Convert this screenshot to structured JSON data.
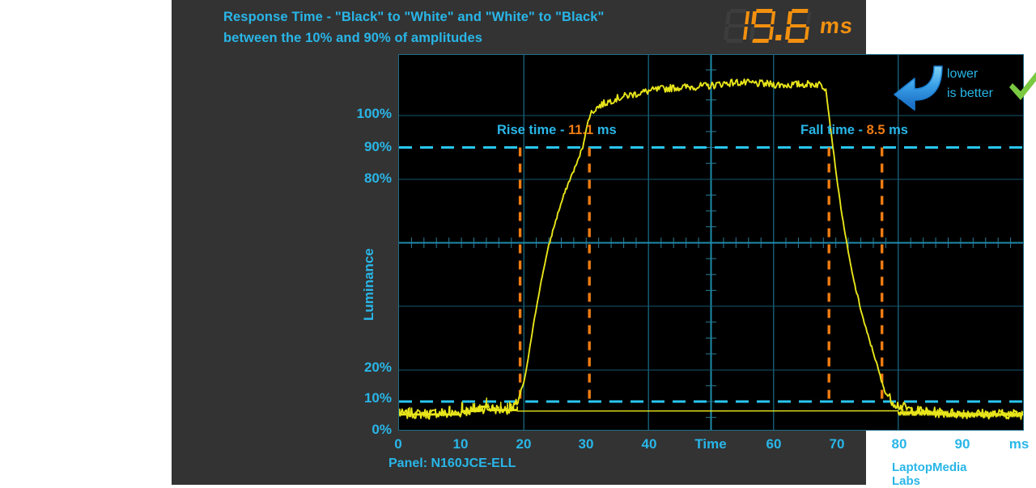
{
  "chart_data": {
    "type": "line",
    "title": "Response Time - \"Black\" to \"White\" and \"White\" to \"Black\"\nbetween the 10% and 90% of amplitudes",
    "xlabel": "Time",
    "ylabel": "Luminance",
    "xunit": "ms",
    "xlim": [
      0,
      100
    ],
    "ylim": [
      -4,
      108
    ],
    "grid": true,
    "legend": "none",
    "xticks": [
      "0",
      "10",
      "20",
      "30",
      "40",
      "Time",
      "60",
      "70",
      "80",
      "90",
      "ms"
    ],
    "xtick_values": [
      0,
      10,
      20,
      30,
      40,
      50,
      60,
      70,
      80,
      90,
      100
    ],
    "yticks": [
      "100%",
      "90%",
      "80%",
      "20%",
      "10%",
      "0%"
    ],
    "ytick_values": [
      100,
      90,
      80,
      20,
      10,
      0
    ],
    "threshold_lines": [
      {
        "label": "90%",
        "value": 90,
        "color": "#29b6e8",
        "style": "dashed"
      },
      {
        "label": "10%",
        "value": 10,
        "color": "#29b6e8",
        "style": "dashed"
      }
    ],
    "markers": [
      {
        "label": "rise-start",
        "x": 19.4,
        "color": "#ef7c12",
        "style": "dashed"
      },
      {
        "label": "rise-end",
        "x": 30.5,
        "color": "#ef7c12",
        "style": "dashed"
      },
      {
        "label": "fall-start",
        "x": 68.9,
        "color": "#ef7c12",
        "style": "dashed"
      },
      {
        "label": "fall-end",
        "x": 77.4,
        "color": "#ef7c12",
        "style": "dashed"
      }
    ],
    "series": [
      {
        "name": "Luminance response",
        "color": "#e8e51a",
        "x": [
          0,
          1,
          2,
          3,
          4,
          5,
          6,
          7,
          8,
          9,
          10,
          11,
          12,
          13,
          14,
          15,
          16,
          17,
          18,
          18.6,
          19.2,
          19.6,
          20,
          20.5,
          21,
          21.6,
          22.2,
          22.8,
          23.4,
          24,
          24.8,
          25.6,
          26.4,
          27.2,
          28,
          28.8,
          29.6,
          30.5,
          31.5,
          32.5,
          33.5,
          34.5,
          35.5,
          36.5,
          37.5,
          38.5,
          40,
          42,
          44,
          46,
          48,
          50,
          52,
          54,
          56,
          58,
          60,
          62,
          64,
          66,
          67.5,
          68.4,
          68.9,
          69.3,
          69.7,
          70.1,
          70.5,
          71,
          71.5,
          72,
          72.6,
          73.2,
          73.8,
          74.4,
          75,
          75.6,
          76.2,
          76.8,
          77.4,
          78,
          78.8,
          79.6,
          80.4,
          81.2,
          82,
          83,
          84,
          85,
          86,
          88,
          90,
          92,
          94,
          96,
          98,
          100
        ],
        "y": [
          0.8,
          0.6,
          1.0,
          0.7,
          0.9,
          0.6,
          1.1,
          0.8,
          0.6,
          1.0,
          1.2,
          1.6,
          2.0,
          2.6,
          2.2,
          2.4,
          2.0,
          2.1,
          2.3,
          3.0,
          5.5,
          8.0,
          10.0,
          15.0,
          21.0,
          28.0,
          34.5,
          40.5,
          46.0,
          51.0,
          56.5,
          61.5,
          66.0,
          70.0,
          73.5,
          77.0,
          82.0,
          90.0,
          92.0,
          93.2,
          94.0,
          94.8,
          95.3,
          95.8,
          96.2,
          96.6,
          97.2,
          97.8,
          98.2,
          98.4,
          98.6,
          98.8,
          99.5,
          99.8,
          99.6,
          99.4,
          99.2,
          99.0,
          99.2,
          99.3,
          99.2,
          98.0,
          90.0,
          84.0,
          78.0,
          72.0,
          66.5,
          60.0,
          54.5,
          49.0,
          43.0,
          38.0,
          33.5,
          29.0,
          25.0,
          21.5,
          18.0,
          14.0,
          10.0,
          7.0,
          5.0,
          3.8,
          3.0,
          2.5,
          2.0,
          1.7,
          1.5,
          1.3,
          1.2,
          1.0,
          0.9,
          0.8,
          0.8,
          0.7,
          0.7,
          0.7
        ]
      }
    ],
    "annotations": [
      {
        "name": "rise-time",
        "prefix": "Rise time - ",
        "value": "11.1",
        "suffix": " ms"
      },
      {
        "name": "fall-time",
        "prefix": "Fall time - ",
        "value": "8.5",
        "suffix": " ms"
      }
    ]
  },
  "readout": {
    "value": "19.6",
    "unit": "ms",
    "digits": [
      "1",
      "9",
      ".",
      "6"
    ],
    "color": "#f2900f",
    "ghost_color": "#3d3d3d"
  },
  "badge": {
    "text": "lower\nis better",
    "arrow_icon": "down-arrow-icon",
    "check_icon": "check-icon",
    "arrow_color": "#2f8fe0",
    "check_color": "#7ac943"
  },
  "footer": {
    "panel": "Panel: N160JCE-ELL",
    "brand": "LaptopMedia Labs"
  },
  "colors": {
    "card_bg": "#333333",
    "plot_bg": "#000000",
    "accent": "#29b6e8",
    "orange": "#ef7c12",
    "trace": "#e8e51a",
    "grid_major": "#14596e",
    "grid_bright": "#1f8bad"
  }
}
